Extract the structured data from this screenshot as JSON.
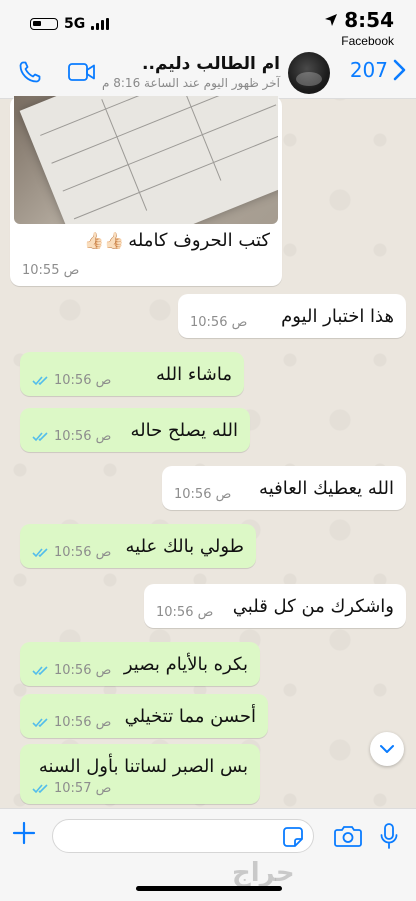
{
  "status_bar": {
    "network": "5G",
    "time": "8:54",
    "back_app": "Facebook"
  },
  "header": {
    "back_count": "207",
    "contact_name": "ام الطالب دليم..",
    "last_seen": "آخر ظهور اليوم عند الساعة 8:16 م"
  },
  "messages": [
    {
      "type": "image",
      "direction": "in",
      "caption": "كتب الحروف كامله",
      "emoji": "👍🏻👍🏻",
      "time": "10:55 ص"
    },
    {
      "direction": "in",
      "text": "هذا اختبار اليوم",
      "time": "10:56 ص"
    },
    {
      "direction": "out",
      "text": "ماشاء الله",
      "time": "10:56 ص",
      "read": true
    },
    {
      "direction": "out",
      "text": "الله يصلح حاله",
      "time": "10:56 ص",
      "read": true
    },
    {
      "direction": "in",
      "text": "الله يعطيك العافيه",
      "time": "10:56 ص"
    },
    {
      "direction": "out",
      "text": "طولي بالك عليه",
      "time": "10:56 ص",
      "read": true
    },
    {
      "direction": "in",
      "text": "واشكرك من كل قلبي",
      "time": "10:56 ص"
    },
    {
      "direction": "out",
      "text": "بكره بالأيام بصير",
      "time": "10:56 ص",
      "read": true
    },
    {
      "direction": "out",
      "text": "أحسن مما تتخيلي",
      "time": "10:56 ص",
      "read": true
    },
    {
      "direction": "out",
      "text": "بس الصبر لساتنا بأول السنه",
      "time": "10:57 ص",
      "read": true
    }
  ],
  "composer": {
    "placeholder": ""
  },
  "watermark": "حراج",
  "colors": {
    "accent": "#0a7cff",
    "outgoing_bubble": "#dcf8c6",
    "incoming_bubble": "#ffffff",
    "read_ticks": "#53bdeb"
  },
  "icons": [
    "battery-icon",
    "signal-icon",
    "location-arrow-icon",
    "back-chevron-icon",
    "video-call-icon",
    "phone-icon",
    "plus-icon",
    "sticker-icon",
    "camera-icon",
    "mic-icon",
    "chevron-down-icon",
    "double-check-icon"
  ]
}
